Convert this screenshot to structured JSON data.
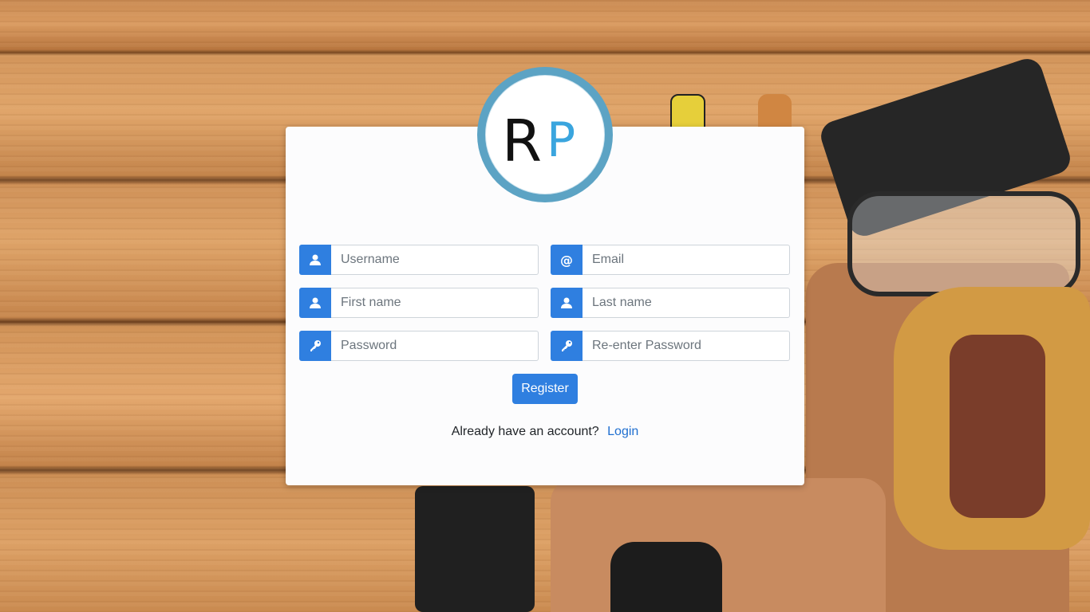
{
  "logo": {
    "letter_left": "R",
    "letter_right": "P",
    "ring_color": "#5ca3c4",
    "accent_color": "#3aa5de"
  },
  "form": {
    "username_placeholder": "Username",
    "email_placeholder": "Email",
    "firstname_placeholder": "First name",
    "lastname_placeholder": "Last name",
    "password_placeholder": "Password",
    "repassword_placeholder": "Re-enter Password",
    "email_icon_glyph": "@",
    "register_label": "Register"
  },
  "footer": {
    "prompt": "Already have an account?",
    "login_label": "Login"
  },
  "colors": {
    "primary": "#2f7fe0",
    "link": "#1f6fd0"
  },
  "icons": {
    "username": "user-icon",
    "email": "at-icon",
    "firstname": "user-icon",
    "lastname": "user-icon",
    "password": "key-icon",
    "repassword": "key-icon"
  }
}
